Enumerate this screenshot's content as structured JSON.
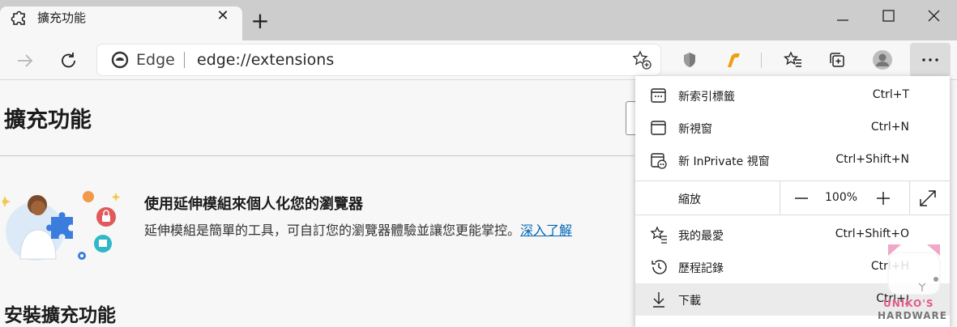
{
  "tab": {
    "title": "擴充功能",
    "icon": "puzzle-icon"
  },
  "window_controls": {
    "minimize": "minimize-icon",
    "maximize": "maximize-icon",
    "close": "close-icon"
  },
  "address_bar": {
    "site_name": "Edge",
    "url": "edge://extensions"
  },
  "page": {
    "title": "擴充功能",
    "promo_title": "使用延伸模組來個人化您的瀏覽器",
    "promo_desc": "延伸模組是簡單的工具，可自訂您的瀏覽器體驗並讓您更能掌控。",
    "promo_link": "深入了解",
    "section_title": "安裝擴充功能"
  },
  "menu": {
    "items": [
      {
        "label": "新索引標籤",
        "shortcut": "Ctrl+T",
        "icon": "new-tab-icon"
      },
      {
        "label": "新視窗",
        "shortcut": "Ctrl+N",
        "icon": "new-window-icon"
      },
      {
        "label": "新 InPrivate 視窗",
        "shortcut": "Ctrl+Shift+N",
        "icon": "inprivate-icon"
      }
    ],
    "zoom": {
      "label": "縮放",
      "value": "100%"
    },
    "items2": [
      {
        "label": "我的最愛",
        "shortcut": "Ctrl+Shift+O",
        "icon": "favorites-icon"
      },
      {
        "label": "歷程記錄",
        "shortcut": "Ctrl+H",
        "icon": "history-icon"
      },
      {
        "label": "下載",
        "shortcut": "Ctrl+J",
        "icon": "download-icon"
      }
    ]
  },
  "watermark": {
    "line1": "UNIKO'S",
    "line2": "HARDWARE"
  },
  "colors": {
    "accent_link": "#0066b4",
    "tabstrip": "#cdcdcd",
    "hover": "#ebebeb"
  }
}
